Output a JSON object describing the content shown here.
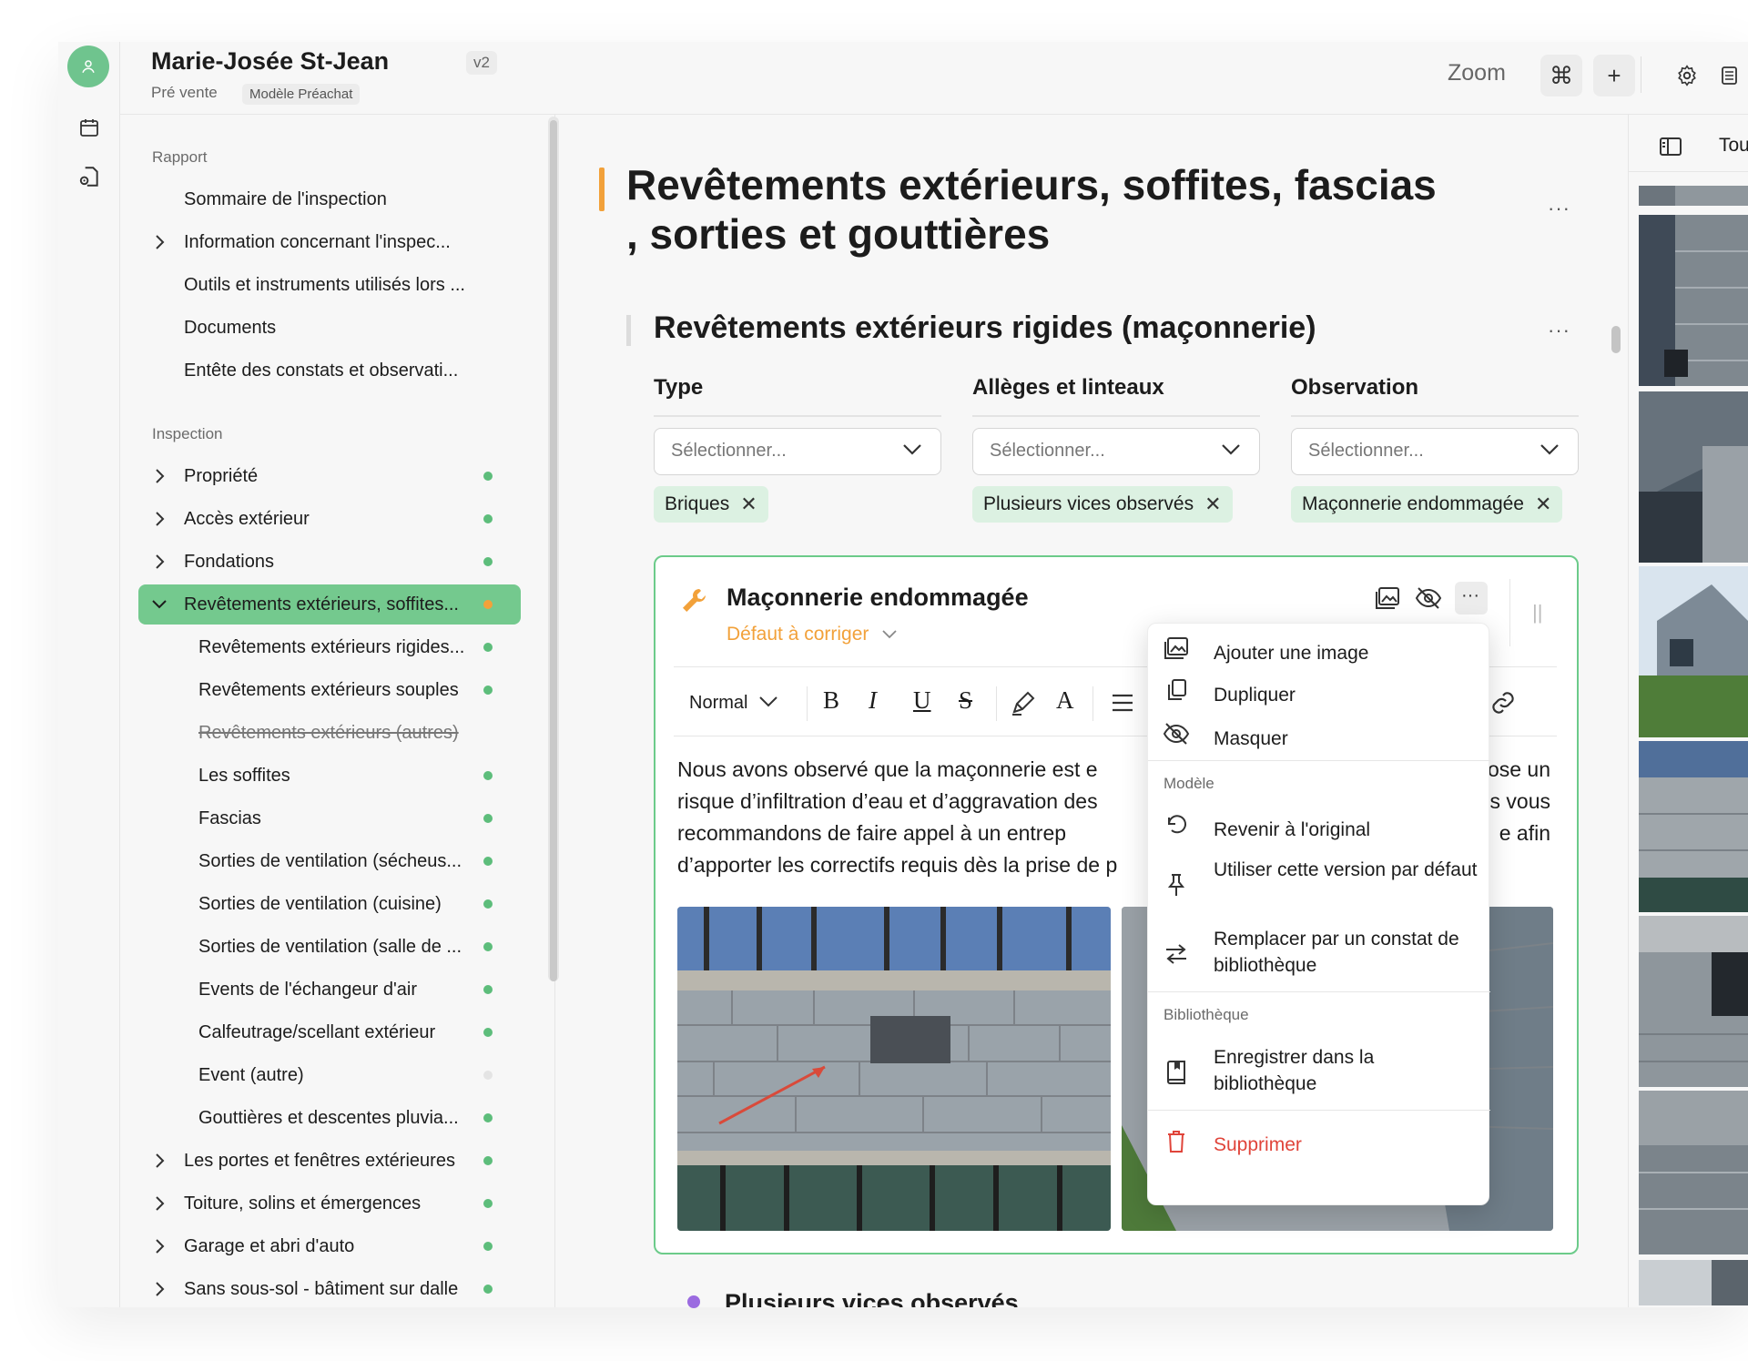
{
  "header": {
    "client_name": "Marie-Josée St-Jean",
    "version": "v2",
    "stage": "Pré vente",
    "template": "Modèle Préachat",
    "zoom_label": "Zoom",
    "cmd_symbol": "⌘",
    "plus_symbol": "+"
  },
  "right_panel": {
    "tab_label": "Tou"
  },
  "nav": {
    "sections": [
      {
        "label": "Rapport"
      },
      {
        "label": "Inspection"
      }
    ],
    "rapport_items": [
      {
        "label": "Sommaire de l'inspection"
      },
      {
        "label": "Information concernant l'inspec..."
      },
      {
        "label": "Outils et instruments utilisés lors ..."
      },
      {
        "label": "Documents"
      },
      {
        "label": "Entête des constats et observati..."
      }
    ],
    "inspection_items": [
      {
        "label": "Propriété"
      },
      {
        "label": "Accès extérieur"
      },
      {
        "label": "Fondations"
      },
      {
        "label": "Revêtements extérieurs, soffites..."
      },
      {
        "label": "Revêtements extérieurs rigides..."
      },
      {
        "label": "Revêtements extérieurs souples"
      },
      {
        "label": "Revêtements extérieurs (autres)"
      },
      {
        "label": "Les soffites"
      },
      {
        "label": "Fascias"
      },
      {
        "label": "Sorties de ventilation (sécheus..."
      },
      {
        "label": "Sorties de ventilation (cuisine)"
      },
      {
        "label": "Sorties de ventilation (salle de ..."
      },
      {
        "label": "Events de l'échangeur d'air"
      },
      {
        "label": "Calfeutrage/scellant extérieur"
      },
      {
        "label": "Event (autre)"
      },
      {
        "label": "Gouttières et descentes pluvia..."
      },
      {
        "label": "Les portes et fenêtres extérieures"
      },
      {
        "label": "Toiture, solins et émergences"
      },
      {
        "label": "Garage et abri d'auto"
      },
      {
        "label": "Sans sous-sol - bâtiment sur dalle"
      }
    ]
  },
  "main": {
    "page_title": "Revêtements extérieurs, soffites, fascias , sorties et gouttières",
    "subsection_title": "Revêtements extérieurs rigides (maçonnerie)",
    "more_symbol": "···",
    "fields": [
      {
        "label": "Type",
        "placeholder": "Sélectionner...",
        "chip": "Briques"
      },
      {
        "label": "Allèges et linteaux",
        "placeholder": "Sélectionner...",
        "chip": "Plusieurs vices observés"
      },
      {
        "label": "Observation",
        "placeholder": "Sélectionner...",
        "chip": "Maçonnerie endommagée"
      }
    ],
    "chip_remove": "✕",
    "card": {
      "title": "Maçonnerie endommagée",
      "status": "Défaut à corriger",
      "toolbar": {
        "style": "Normal",
        "bold": "B",
        "italic": "I",
        "underline": "U",
        "strike": "S",
        "font_color": "A"
      },
      "body_line1_left": "Nous avons observé que la maçonnerie est e",
      "body_line1_right": "ose un",
      "body_line2_left": "risque d’infiltration d’eau et d’aggravation des",
      "body_line2_right": "s vous",
      "body_line3_left": "recommandons de faire appel à un entrep",
      "body_line3_right": "e afin",
      "body_line4_left": "d’apporter les correctifs requis dès la prise de p"
    },
    "next_item_title": "Plusieurs vices observés"
  },
  "menu": {
    "items": [
      {
        "label": "Ajouter une image"
      },
      {
        "label": "Dupliquer"
      },
      {
        "label": "Masquer"
      }
    ],
    "group_model": "Modèle",
    "model_items": [
      {
        "label": "Revenir à l'original"
      },
      {
        "label": "Utiliser cette version par défaut"
      },
      {
        "label": "Remplacer par un constat de bibliothèque"
      }
    ],
    "group_library": "Bibliothèque",
    "library_items": [
      {
        "label": "Enregistrer dans la bibliothèque"
      }
    ],
    "delete_label": "Supprimer"
  },
  "colors": {
    "accent_green": "#74c98e",
    "status_orange": "#f2a13a",
    "chip_green": "#dcf1e2",
    "danger_red": "#e0443a"
  }
}
